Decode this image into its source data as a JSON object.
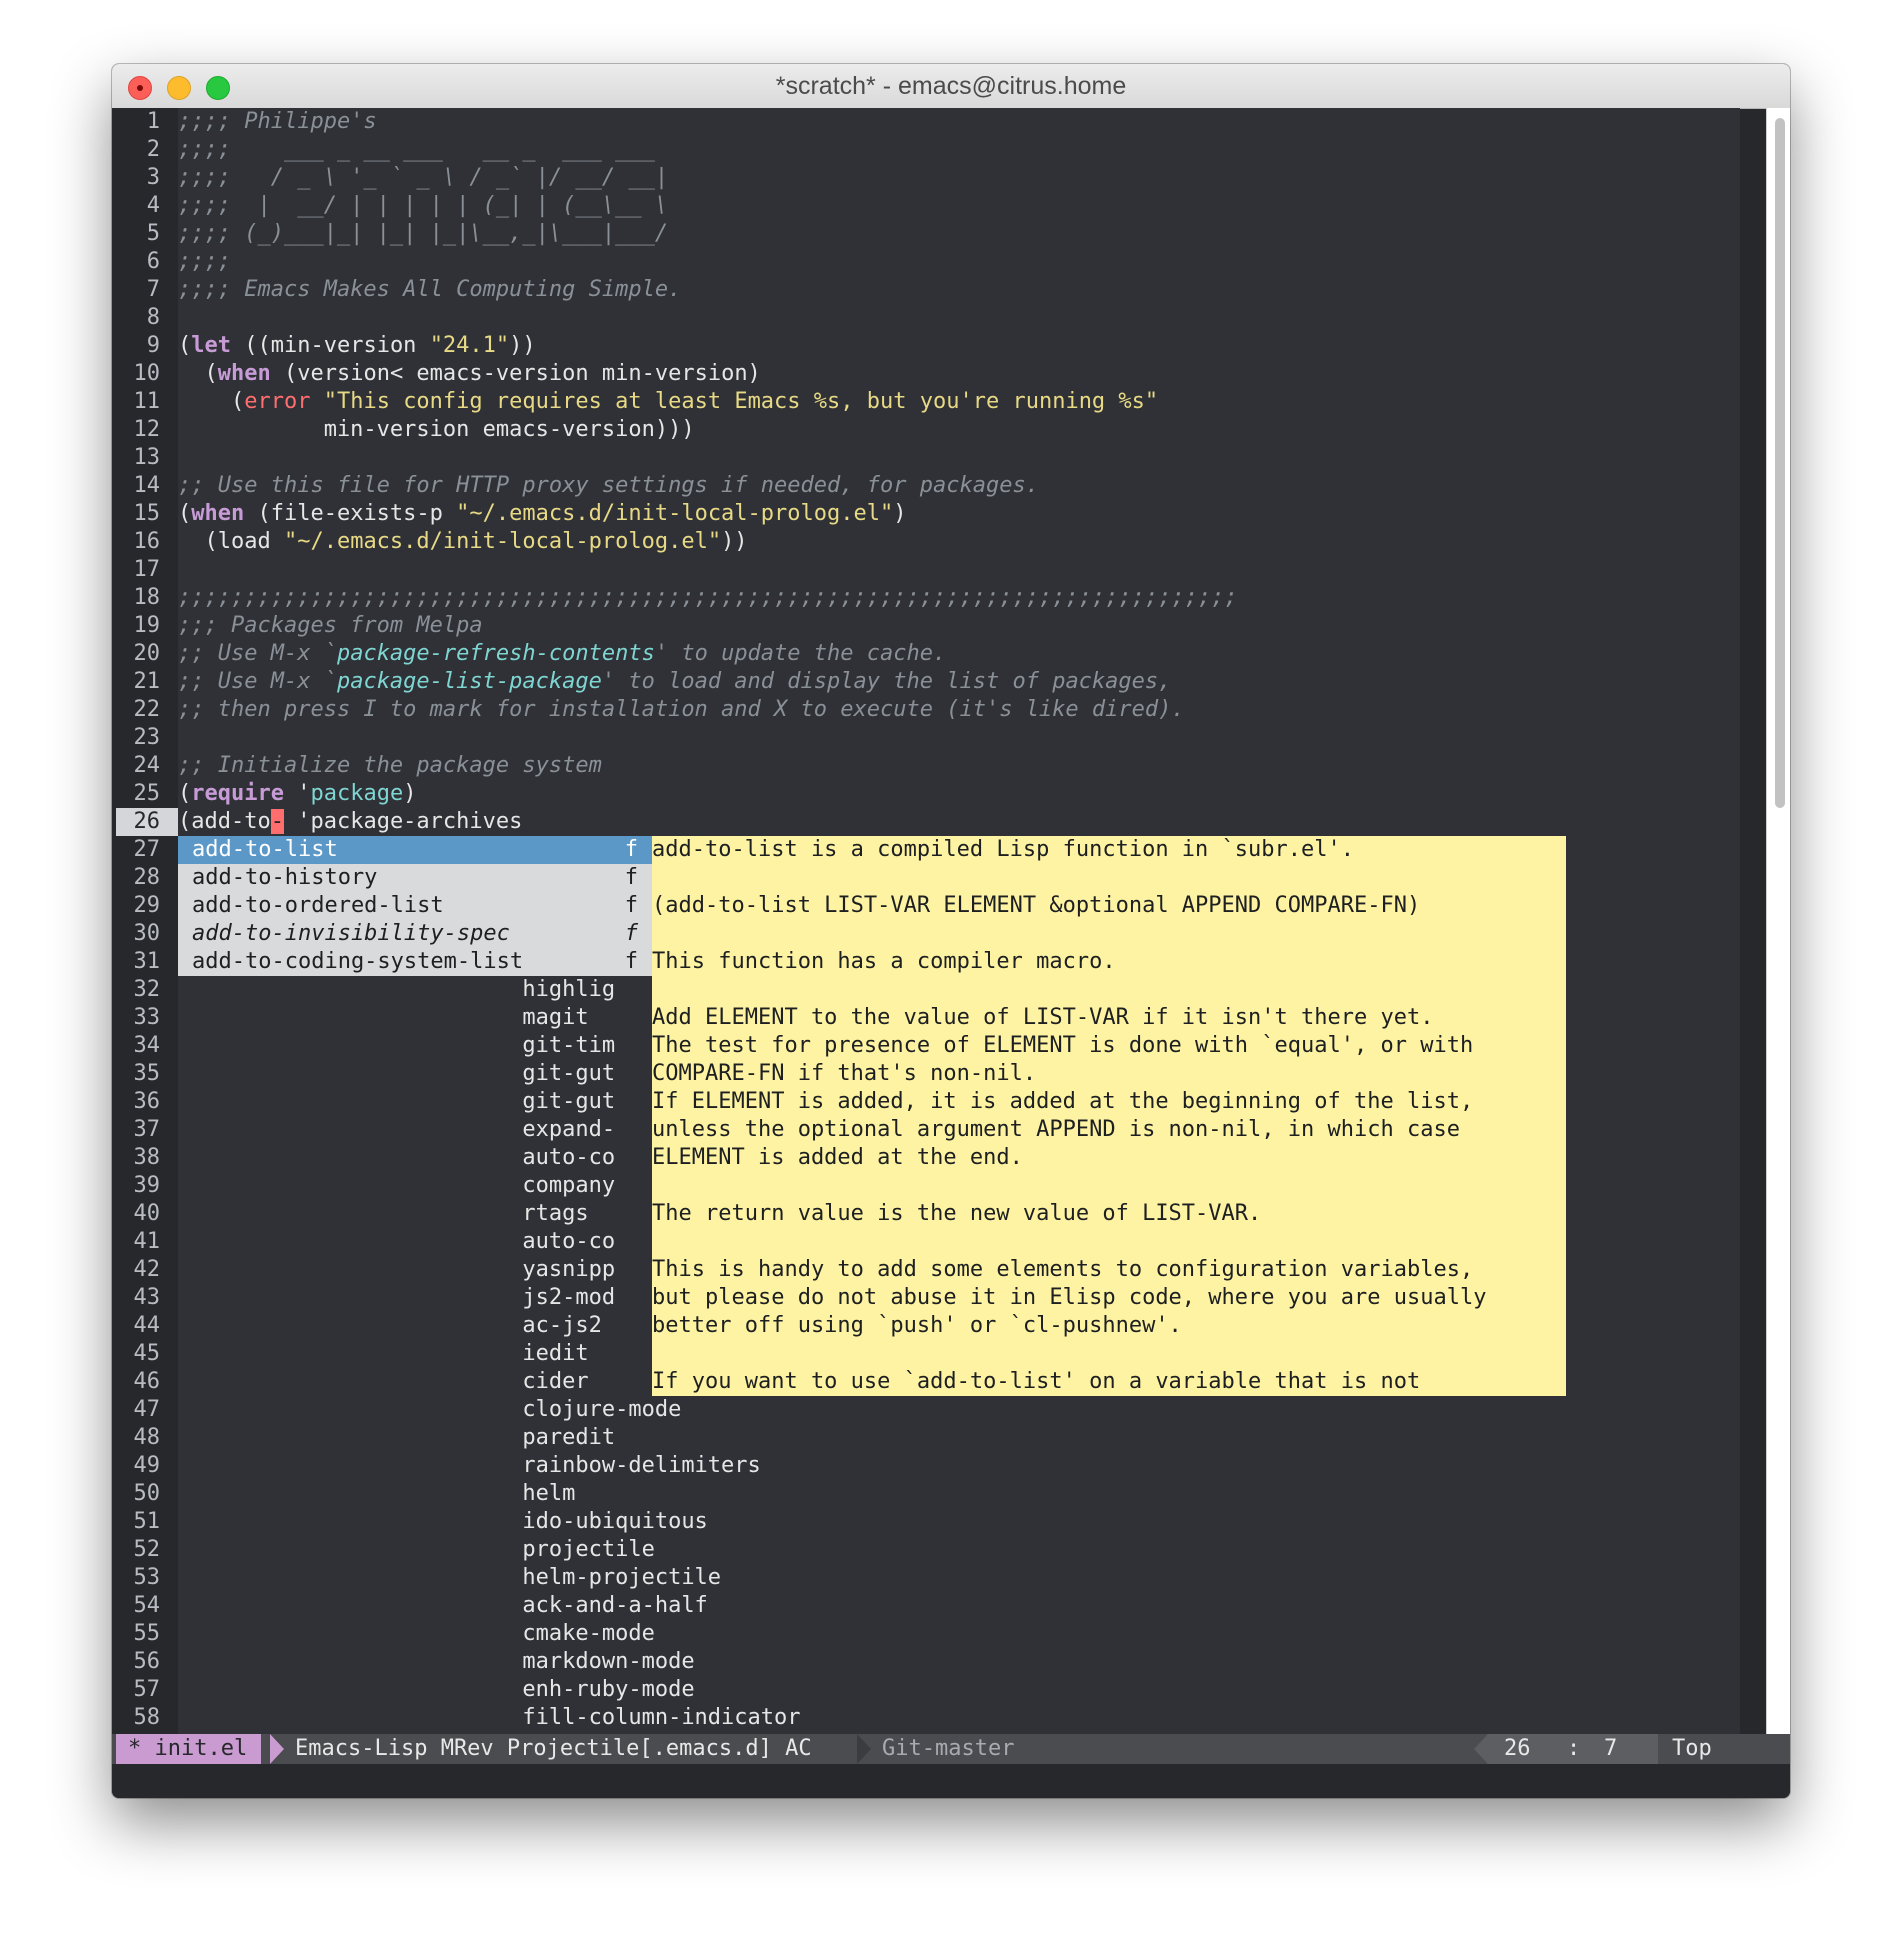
{
  "window": {
    "title": "*scratch* - emacs@citrus.home",
    "buttons": [
      "close",
      "minimize",
      "zoom"
    ]
  },
  "editor": {
    "current_line": 26,
    "lines": [
      {
        "n": "1",
        "segs": [
          {
            "t": ";;;; Philippe's",
            "c": "cm"
          }
        ]
      },
      {
        "n": "2",
        "segs": [
          {
            "t": ";;;;    ___ _ __ ___   __ _  ___ ___",
            "c": "cm"
          }
        ]
      },
      {
        "n": "3",
        "segs": [
          {
            "t": ";;;;   / _ \\ '_ ` _ \\ / _` |/ __/ __|",
            "c": "cm"
          }
        ]
      },
      {
        "n": "4",
        "segs": [
          {
            "t": ";;;;  |  __/ | | | | | (_| | (__\\__ \\",
            "c": "cm"
          }
        ]
      },
      {
        "n": "5",
        "segs": [
          {
            "t": ";;;; (_)___|_| |_| |_|\\__,_|\\___|___/",
            "c": "cm"
          }
        ]
      },
      {
        "n": "6",
        "segs": [
          {
            "t": ";;;;",
            "c": "cm"
          }
        ]
      },
      {
        "n": "7",
        "segs": [
          {
            "t": ";;;; Emacs Makes All Computing Simple.",
            "c": "cm"
          }
        ]
      },
      {
        "n": "8",
        "segs": []
      },
      {
        "n": "9",
        "segs": [
          {
            "t": "(",
            "c": ""
          },
          {
            "t": "let",
            "c": "kw"
          },
          {
            "t": " ((min-version ",
            "c": ""
          },
          {
            "t": "\"24.1\"",
            "c": "st"
          },
          {
            "t": "))",
            "c": ""
          }
        ]
      },
      {
        "n": "10",
        "segs": [
          {
            "t": "  (",
            "c": ""
          },
          {
            "t": "when",
            "c": "kw"
          },
          {
            "t": " (version< emacs-version min-version)",
            "c": ""
          }
        ]
      },
      {
        "n": "11",
        "segs": [
          {
            "t": "    (",
            "c": ""
          },
          {
            "t": "error",
            "c": "er"
          },
          {
            "t": " ",
            "c": ""
          },
          {
            "t": "\"This config requires at least Emacs %s, but you're running %s\"",
            "c": "st"
          }
        ]
      },
      {
        "n": "12",
        "segs": [
          {
            "t": "           min-version emacs-version)))",
            "c": ""
          }
        ]
      },
      {
        "n": "13",
        "segs": []
      },
      {
        "n": "14",
        "segs": [
          {
            "t": ";; Use this file for HTTP proxy settings if needed, for packages.",
            "c": "cm"
          }
        ]
      },
      {
        "n": "15",
        "segs": [
          {
            "t": "(",
            "c": ""
          },
          {
            "t": "when",
            "c": "kw"
          },
          {
            "t": " (file-exists-p ",
            "c": ""
          },
          {
            "t": "\"~/.emacs.d/init-local-prolog.el\"",
            "c": "st"
          },
          {
            "t": ")",
            "c": ""
          }
        ]
      },
      {
        "n": "16",
        "segs": [
          {
            "t": "  (load ",
            "c": ""
          },
          {
            "t": "\"~/.emacs.d/init-local-prolog.el\"",
            "c": "st"
          },
          {
            "t": "))",
            "c": ""
          }
        ]
      },
      {
        "n": "17",
        "segs": []
      },
      {
        "n": "18",
        "segs": [
          {
            "t": ";;;;;;;;;;;;;;;;;;;;;;;;;;;;;;;;;;;;;;;;;;;;;;;;;;;;;;;;;;;;;;;;;;;;;;;;;;;;;;;;",
            "c": "cm"
          }
        ]
      },
      {
        "n": "19",
        "segs": [
          {
            "t": ";;; Packages from Melpa",
            "c": "cm"
          }
        ]
      },
      {
        "n": "20",
        "segs": [
          {
            "t": ";; Use M-x `",
            "c": "cm"
          },
          {
            "t": "package-refresh-contents",
            "c": "ln"
          },
          {
            "t": "' to update the cache.",
            "c": "cm"
          }
        ]
      },
      {
        "n": "21",
        "segs": [
          {
            "t": ";; Use M-x `",
            "c": "cm"
          },
          {
            "t": "package-list-package",
            "c": "ln"
          },
          {
            "t": "' to load and display the list of packages,",
            "c": "cm"
          }
        ]
      },
      {
        "n": "22",
        "segs": [
          {
            "t": ";; then press I to mark for installation and X to execute (it's like dired).",
            "c": "cm"
          }
        ]
      },
      {
        "n": "23",
        "segs": []
      },
      {
        "n": "24",
        "segs": [
          {
            "t": ";; Initialize the package system",
            "c": "cm"
          }
        ]
      },
      {
        "n": "25",
        "segs": [
          {
            "t": "(",
            "c": ""
          },
          {
            "t": "require",
            "c": "kw"
          },
          {
            "t": " '",
            "c": ""
          },
          {
            "t": "package",
            "c": "qt"
          },
          {
            "t": ")",
            "c": ""
          }
        ]
      },
      {
        "n": "26",
        "segs": [
          {
            "t": "(add-to",
            "c": ""
          },
          {
            "t": "-",
            "c": "cursor"
          },
          {
            "t": " '",
            "c": ""
          },
          {
            "t": "package-archives",
            "c": ""
          }
        ]
      },
      {
        "n": "27",
        "segs": []
      },
      {
        "n": "28",
        "segs": []
      },
      {
        "n": "29",
        "segs": []
      },
      {
        "n": "30",
        "segs": []
      },
      {
        "n": "31",
        "segs": []
      },
      {
        "n": "32",
        "segs": [
          {
            "t": "                          highlig",
            "c": ""
          }
        ]
      },
      {
        "n": "33",
        "segs": [
          {
            "t": "                          magit",
            "c": ""
          }
        ]
      },
      {
        "n": "34",
        "segs": [
          {
            "t": "                          git-tim",
            "c": ""
          }
        ]
      },
      {
        "n": "35",
        "segs": [
          {
            "t": "                          git-gut",
            "c": ""
          }
        ]
      },
      {
        "n": "36",
        "segs": [
          {
            "t": "                          git-gut",
            "c": ""
          }
        ]
      },
      {
        "n": "37",
        "segs": [
          {
            "t": "                          expand-",
            "c": ""
          }
        ]
      },
      {
        "n": "38",
        "segs": [
          {
            "t": "                          auto-co",
            "c": ""
          }
        ]
      },
      {
        "n": "39",
        "segs": [
          {
            "t": "                          company",
            "c": ""
          }
        ]
      },
      {
        "n": "40",
        "segs": [
          {
            "t": "                          rtags",
            "c": ""
          }
        ]
      },
      {
        "n": "41",
        "segs": [
          {
            "t": "                          auto-co",
            "c": ""
          }
        ]
      },
      {
        "n": "42",
        "segs": [
          {
            "t": "                          yasnipp",
            "c": ""
          }
        ]
      },
      {
        "n": "43",
        "segs": [
          {
            "t": "                          js2-mod",
            "c": ""
          }
        ]
      },
      {
        "n": "44",
        "segs": [
          {
            "t": "                          ac-js2",
            "c": ""
          }
        ]
      },
      {
        "n": "45",
        "segs": [
          {
            "t": "                          iedit",
            "c": ""
          }
        ]
      },
      {
        "n": "46",
        "segs": [
          {
            "t": "                          cider",
            "c": ""
          }
        ]
      },
      {
        "n": "47",
        "segs": [
          {
            "t": "                          clojure-mode",
            "c": ""
          }
        ]
      },
      {
        "n": "48",
        "segs": [
          {
            "t": "                          paredit",
            "c": ""
          }
        ]
      },
      {
        "n": "49",
        "segs": [
          {
            "t": "                          rainbow-delimiters",
            "c": ""
          }
        ]
      },
      {
        "n": "50",
        "segs": [
          {
            "t": "                          helm",
            "c": ""
          }
        ]
      },
      {
        "n": "51",
        "segs": [
          {
            "t": "                          ido-ubiquitous",
            "c": ""
          }
        ]
      },
      {
        "n": "52",
        "segs": [
          {
            "t": "                          projectile",
            "c": ""
          }
        ]
      },
      {
        "n": "53",
        "segs": [
          {
            "t": "                          helm-projectile",
            "c": ""
          }
        ]
      },
      {
        "n": "54",
        "segs": [
          {
            "t": "                          ack-and-a-half",
            "c": ""
          }
        ]
      },
      {
        "n": "55",
        "segs": [
          {
            "t": "                          cmake-mode",
            "c": ""
          }
        ]
      },
      {
        "n": "56",
        "segs": [
          {
            "t": "                          markdown-mode",
            "c": ""
          }
        ]
      },
      {
        "n": "57",
        "segs": [
          {
            "t": "                          enh-ruby-mode",
            "c": ""
          }
        ]
      },
      {
        "n": "58",
        "segs": [
          {
            "t": "                          fill-column-indicator",
            "c": ""
          }
        ]
      }
    ]
  },
  "completion": {
    "selected_index": 0,
    "items": [
      {
        "name": "add-to-list",
        "type": "f",
        "italic": false
      },
      {
        "name": "add-to-history",
        "type": "f",
        "italic": false
      },
      {
        "name": "add-to-ordered-list",
        "type": "f",
        "italic": false
      },
      {
        "name": "add-to-invisibility-spec",
        "type": "f",
        "italic": true
      },
      {
        "name": "add-to-coding-system-list",
        "type": "f",
        "italic": false
      }
    ]
  },
  "doc_popup": {
    "lines": [
      "add-to-list is a compiled Lisp function in `subr.el'.",
      "",
      "(add-to-list LIST-VAR ELEMENT &optional APPEND COMPARE-FN)",
      "",
      "This function has a compiler macro.",
      "",
      "Add ELEMENT to the value of LIST-VAR if it isn't there yet.",
      "The test for presence of ELEMENT is done with `equal', or with",
      "COMPARE-FN if that's non-nil.",
      "If ELEMENT is added, it is added at the beginning of the list,",
      "unless the optional argument APPEND is non-nil, in which case",
      "ELEMENT is added at the end.",
      "",
      "The return value is the new value of LIST-VAR.",
      "",
      "This is handy to add some elements to configuration variables,",
      "but please do not abuse it in Elisp code, where you are usually",
      "better off using `push' or `cl-pushnew'.",
      "",
      "If you want to use `add-to-list' on a variable that is not"
    ]
  },
  "modeline": {
    "buffer": "* init.el",
    "modes": "Emacs-Lisp MRev Projectile[.emacs.d] AC",
    "git": "Git-master",
    "line": "26",
    "sep": ":",
    "col": "7",
    "position": "Top"
  }
}
